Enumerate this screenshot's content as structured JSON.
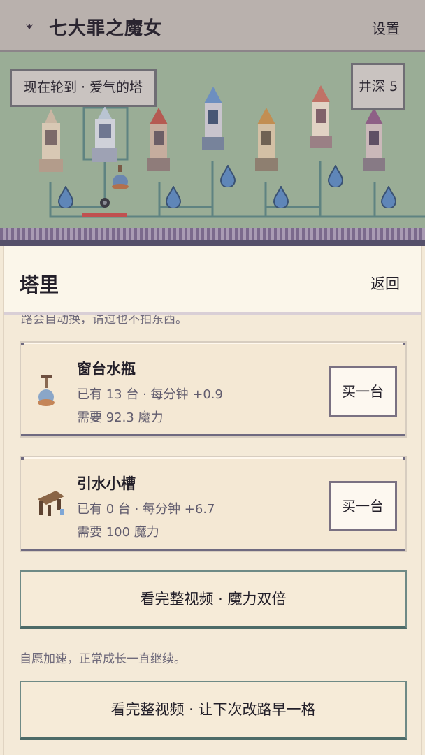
{
  "header": {
    "title": "七大罪之魔女",
    "settings_label": "设置"
  },
  "scene": {
    "turn_label": "现在轮到 · 爱气的塔",
    "depth_label": "井深 5"
  },
  "panel": {
    "title": "塔里",
    "back_label": "返回",
    "cut_text": "路会自动换，请过也不拍东西。",
    "items": [
      {
        "name": "窗台水瓶",
        "owned": "已有 13 台 · 每分钟 +0.9",
        "cost": "需要 92.3 魔力",
        "buy_label": "买一台",
        "icon": "water-bottle-icon"
      },
      {
        "name": "引水小槽",
        "owned": "已有 0 台 · 每分钟 +6.7",
        "cost": "需要 100 魔力",
        "buy_label": "买一台",
        "icon": "water-channel-icon"
      }
    ],
    "video_double_label": "看完整视频 · 魔力双倍",
    "hint_text": "自愿加速，正常成长一直继续。",
    "video_route_label": "看完整视频 · 让下次改路早一格"
  },
  "colors": {
    "scene_bg": "#9aad96",
    "panel_bg": "#f4ead8",
    "header_bg": "#b9b1ad",
    "accent_border": "#6f8a86",
    "drop_blue": "#5f86b8"
  }
}
